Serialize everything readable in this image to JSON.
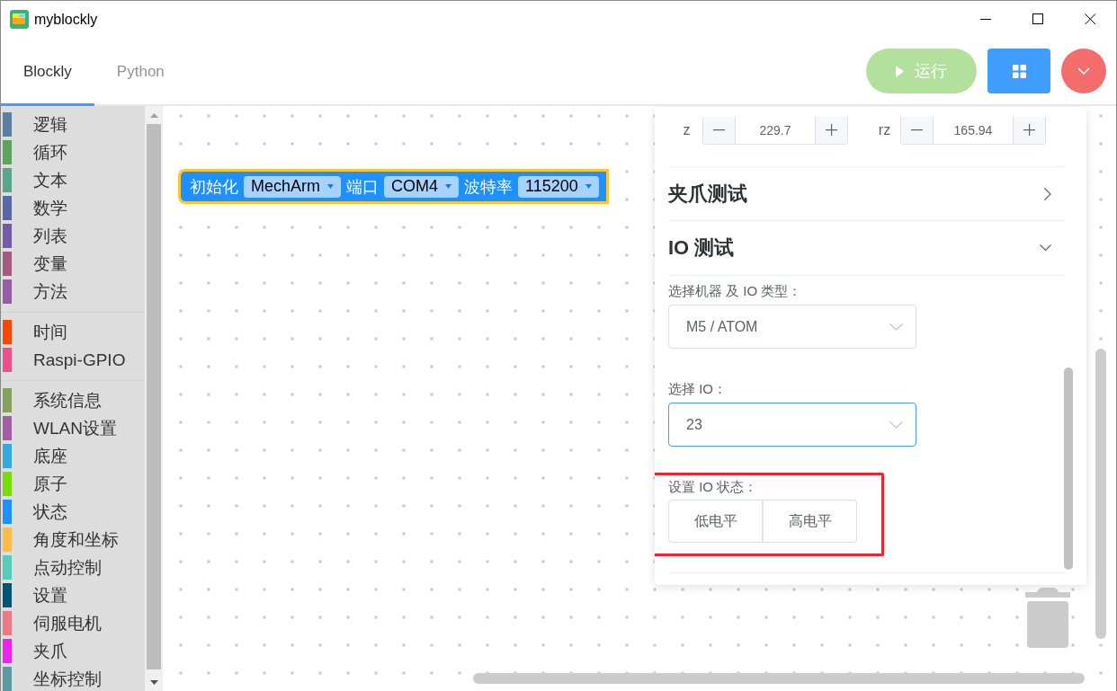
{
  "window": {
    "title": "myblockly"
  },
  "tabs": [
    {
      "label": "Blockly",
      "selected": true
    },
    {
      "label": "Python",
      "selected": false
    }
  ],
  "toolbar": {
    "run_button": {
      "label": "运行",
      "disabled": true
    }
  },
  "sidebar": {
    "groups": [
      [
        {
          "name": "逻辑",
          "color": "#5b80a5"
        },
        {
          "name": "循环",
          "color": "#5ba55b"
        },
        {
          "name": "文本",
          "color": "#5ba58c"
        },
        {
          "name": "数学",
          "color": "#5b67a5"
        },
        {
          "name": "列表",
          "color": "#745ba5"
        },
        {
          "name": "变量",
          "color": "#a55b80"
        },
        {
          "name": "方法",
          "color": "#995ba5"
        }
      ],
      [
        {
          "name": "时间",
          "color": "#ff4500"
        },
        {
          "name": "Raspi-GPIO",
          "color": "#f0508a"
        }
      ],
      [
        {
          "name": "系统信息",
          "color": "#84a05a"
        },
        {
          "name": "WLAN设置",
          "color": "#a55ba5"
        },
        {
          "name": "底座",
          "color": "#33aadd"
        },
        {
          "name": "原子",
          "color": "#77dd00"
        },
        {
          "name": "状态",
          "color": "#1e90ff"
        },
        {
          "name": "角度和坐标",
          "color": "#ffbb44"
        },
        {
          "name": "点动控制",
          "color": "#55ccbb"
        },
        {
          "name": "设置",
          "color": "#005577"
        },
        {
          "name": "伺服电机",
          "color": "#ee7788"
        },
        {
          "name": "夹爪",
          "color": "#ee22ee"
        },
        {
          "name": "坐标控制",
          "color": "#5b99a5"
        }
      ]
    ]
  },
  "block": {
    "selected": true,
    "parts": [
      {
        "kind": "label",
        "text": "初始化"
      },
      {
        "kind": "dropdown",
        "text": "MechArm"
      },
      {
        "kind": "label",
        "text": "端口"
      },
      {
        "kind": "dropdown",
        "text": "COM4"
      },
      {
        "kind": "label",
        "text": "波特率"
      },
      {
        "kind": "dropdown",
        "text": "115200"
      }
    ]
  },
  "panel": {
    "steppers": [
      {
        "label": "z",
        "value": "229.7"
      },
      {
        "label": "rz",
        "value": "165.94"
      }
    ],
    "sections": [
      {
        "title": "夹爪测试",
        "expanded": false
      },
      {
        "title": "IO 测试",
        "expanded": true,
        "fields": [
          {
            "kind": "select",
            "label": "选择机器 及 IO 类型：",
            "value": "M5 / ATOM",
            "focused": false
          },
          {
            "kind": "select",
            "label": "选择 IO：",
            "value": "23",
            "focused": true
          },
          {
            "kind": "buttons",
            "label": "设置 IO 状态：",
            "buttons": [
              "低电平",
              "高电平"
            ],
            "highlighted": true
          }
        ]
      }
    ]
  }
}
